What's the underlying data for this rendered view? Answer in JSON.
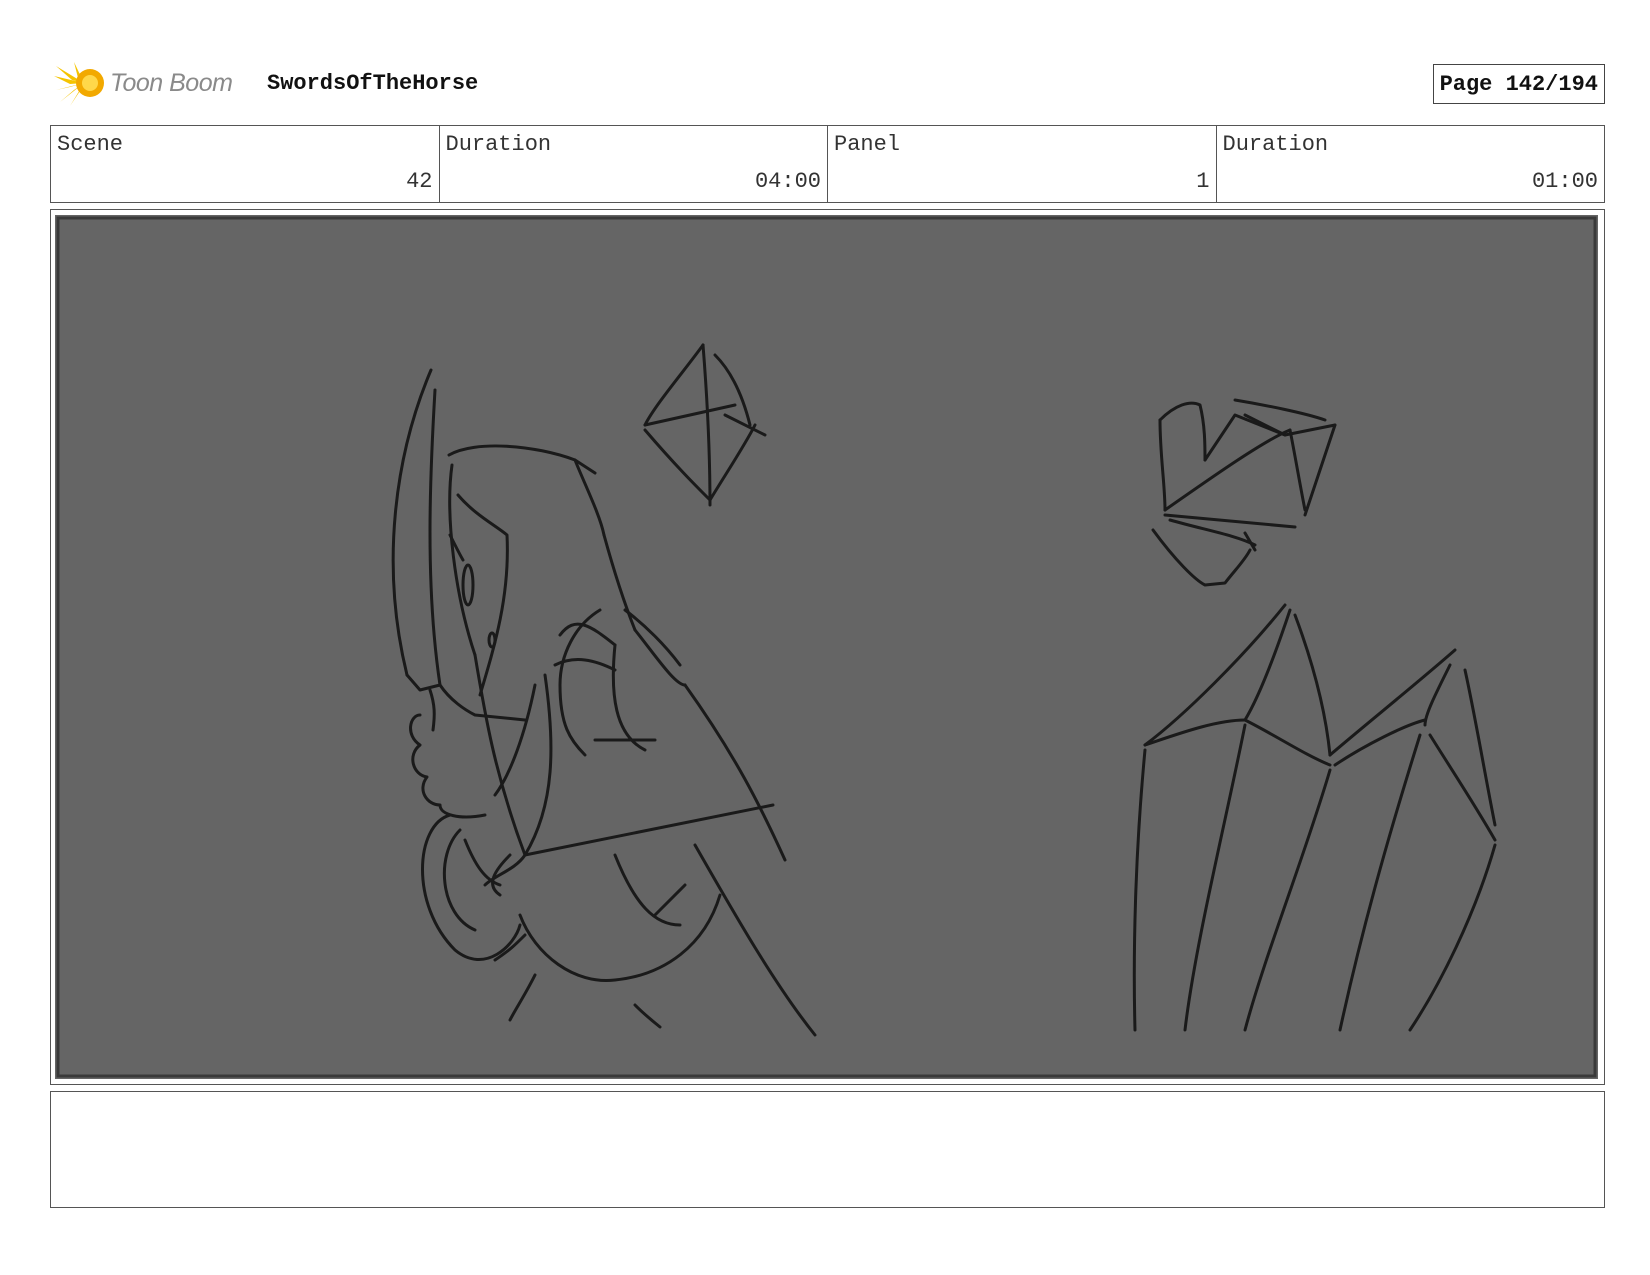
{
  "header": {
    "logo_text": "Toon Boom",
    "project_title": "SwordsOfTheHorse",
    "page_label": "Page 142/194"
  },
  "info": {
    "scene_label": "Scene",
    "scene_value": "42",
    "scene_duration_label": "Duration",
    "scene_duration_value": "04:00",
    "panel_label": "Panel",
    "panel_value": "1",
    "panel_duration_label": "Duration",
    "panel_duration_value": "01:00"
  },
  "colors": {
    "panel_background": "#656565",
    "sketch_line": "#1a1a1a",
    "logo_accent": "#f5c400"
  },
  "notes": {
    "text": ""
  }
}
